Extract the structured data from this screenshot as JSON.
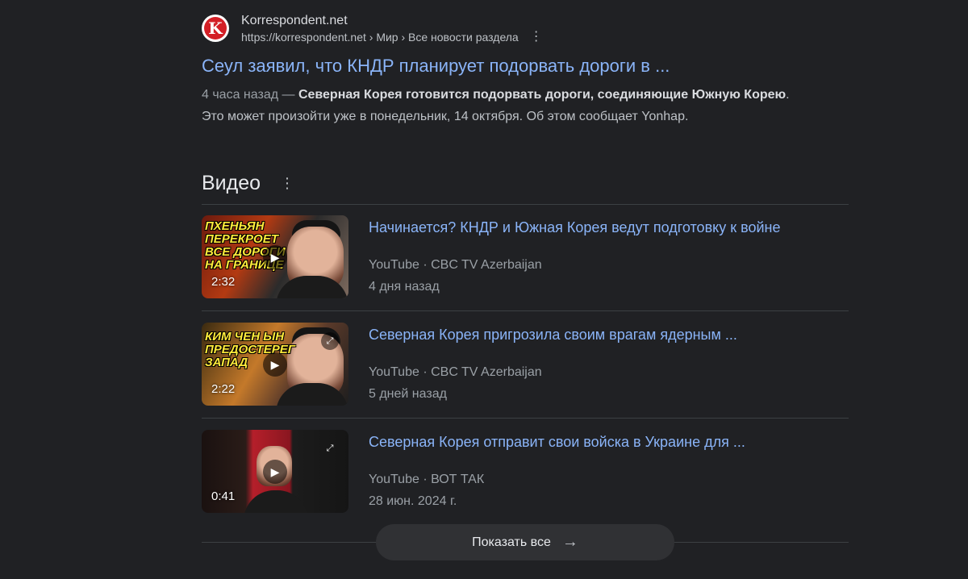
{
  "result": {
    "favicon_letter": "K",
    "site_name": "Korrespondent.net",
    "site_url": "https://korrespondent.net › Мир › Все новости раздела",
    "title": "Сеул заявил, что КНДР планирует подорвать дороги в ...",
    "snippet_date": "4 часа назад —",
    "snippet_bold": "Северная Корея готовится подорвать дороги, соединяющие Южную Корею",
    "snippet_rest": ". Это может произойти уже в понедельник, 14 октября. Об этом сообщает Yonhap."
  },
  "videos_section": {
    "title": "Видео",
    "show_all": "Показать все",
    "items": [
      {
        "title": "Начинается? КНДР и Южная Корея ведут подготовку к войне",
        "source": "YouTube · CBC TV Azerbaijan",
        "date": "4 дня назад",
        "duration": "2:32",
        "thumb_text": "Пхеньян перекроет все дороги на границе"
      },
      {
        "title": "Северная Корея пригрозила своим врагам ядерным ...",
        "source": "YouTube · CBC TV Azerbaijan",
        "date": "5 дней назад",
        "duration": "2:22",
        "thumb_text": "Ким Чен Ын предостерег запад"
      },
      {
        "title": "Северная Корея отправит свои войска в Украине для ...",
        "source": "YouTube · ВОТ ТАК",
        "date": "28 июн. 2024 г.",
        "duration": "0:41",
        "thumb_text": ""
      }
    ]
  },
  "colors": {
    "background": "#202124",
    "link": "#8ab4f8",
    "text": "#bdc1c6",
    "thumb_highlight": "#ffeb3b"
  },
  "icons": [
    "kebab-menu-icon",
    "play-icon",
    "fullscreen-icon",
    "arrow-right-icon"
  ]
}
